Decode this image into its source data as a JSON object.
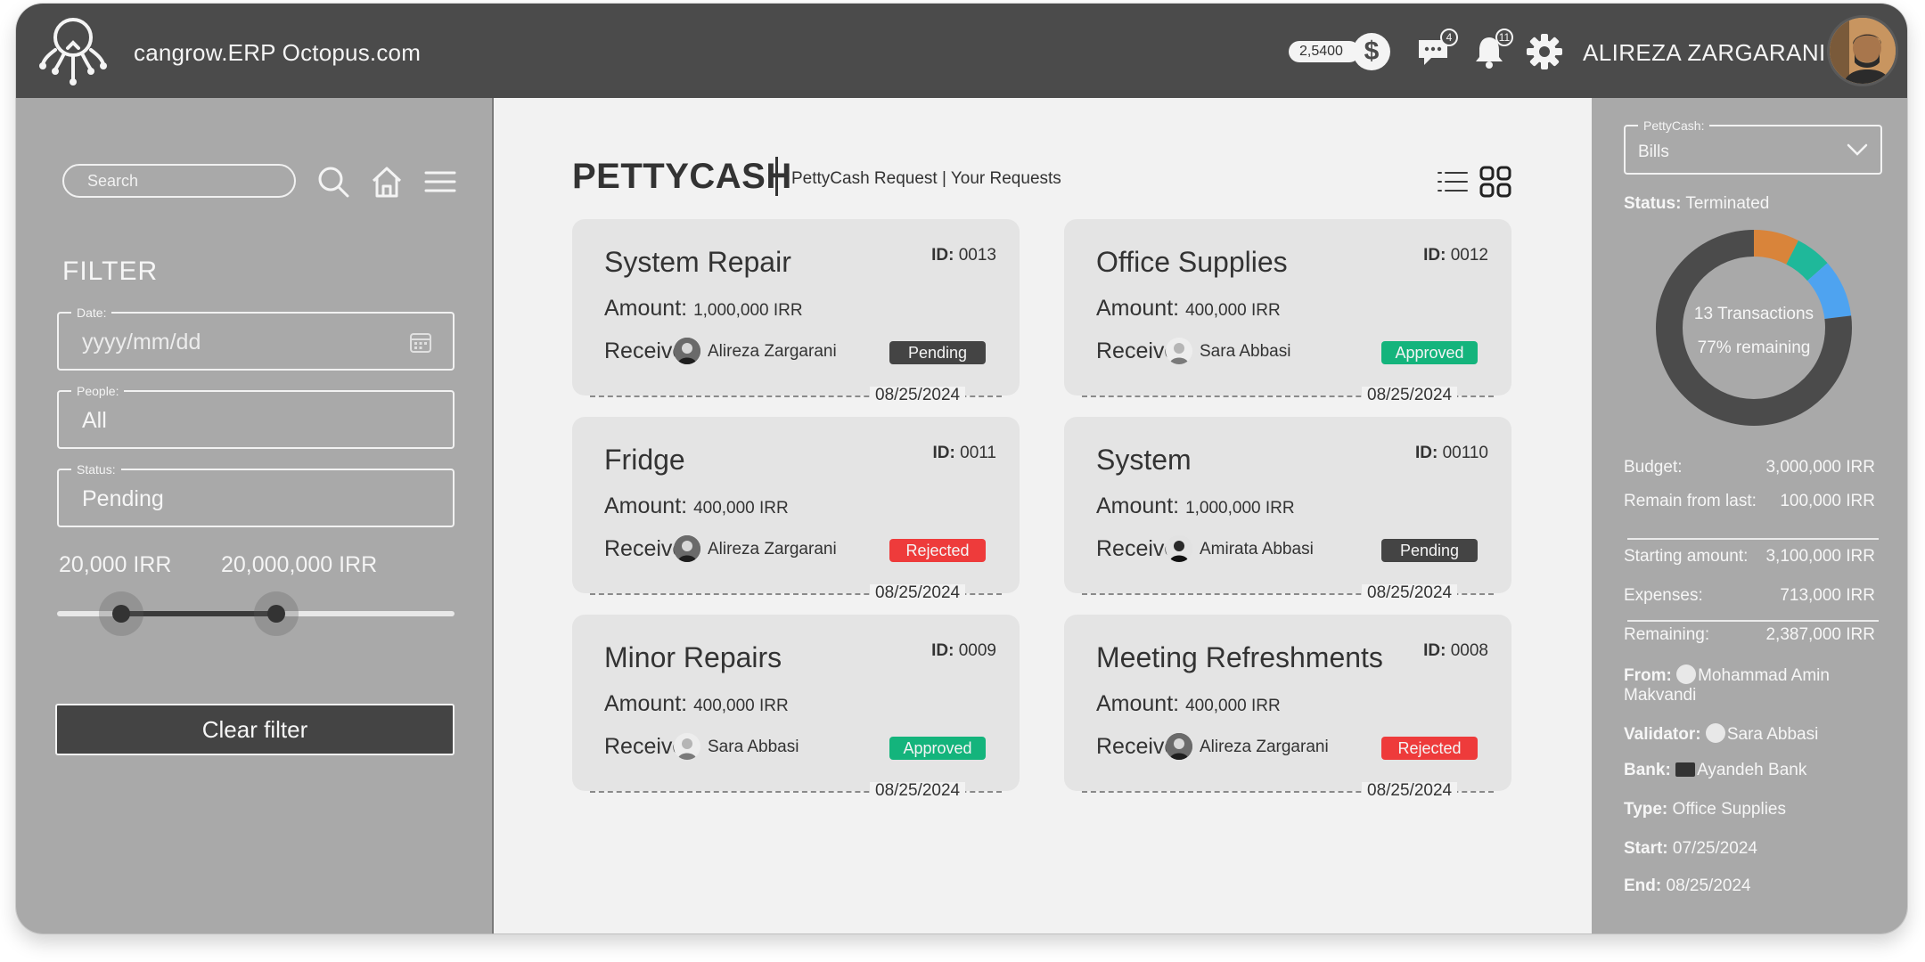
{
  "header": {
    "app_title": "cangrow.ERP Octopus.com",
    "balance": "2,5400",
    "currency_symbol": "$",
    "messages_count": "4",
    "notifications_count": "11",
    "user_name": "ALIREZA ZARGARANI"
  },
  "sidebar": {
    "search_placeholder": "Search",
    "filter_title": "FILTER",
    "date": {
      "label": "Date:",
      "value": "yyyy/mm/dd"
    },
    "people": {
      "label": "People:",
      "value": "All"
    },
    "status": {
      "label": "Status:",
      "value": "Pending"
    },
    "range_min": "20,000 IRR",
    "range_max": "20,000,000 IRR",
    "range_min_fraction": 0.16,
    "range_max_fraction": 0.55,
    "clear_button": "Clear filter"
  },
  "main": {
    "title": "PETTYCASH",
    "breadcrumb": "PettyCash Request | Your Requests",
    "amount_label": "Amount:",
    "receiver_label": "Receiver:",
    "id_label": "ID:",
    "cards": [
      {
        "title": "System Repair",
        "id": "0013",
        "amount": "1,000,000 IRR",
        "receiver": "Alireza Zargarani",
        "status": "Pending",
        "date": "08/25/2024"
      },
      {
        "title": "Office Supplies",
        "id": "0012",
        "amount": "400,000 IRR",
        "receiver": "Sara Abbasi",
        "status": "Approved",
        "date": "08/25/2024"
      },
      {
        "title": "Fridge",
        "id": "0011",
        "amount": "400,000 IRR",
        "receiver": "Alireza Zargarani",
        "status": "Rejected",
        "date": "08/25/2024"
      },
      {
        "title": "System",
        "id": "00110",
        "amount": "1,000,000 IRR",
        "receiver": "Amirata Abbasi",
        "status": "Pending",
        "date": "08/25/2024"
      },
      {
        "title": "Minor Repairs",
        "id": "0009",
        "amount": "400,000 IRR",
        "receiver": "Sara Abbasi",
        "status": "Approved",
        "date": "08/25/2024"
      },
      {
        "title": "Meeting Refreshments",
        "id": "0008",
        "amount": "400,000 IRR",
        "receiver": "Alireza Zargarani",
        "status": "Rejected",
        "date": "08/25/2024"
      }
    ]
  },
  "details": {
    "pettycash_label": "PettyCash:",
    "pettycash_value": "Bills",
    "status_label": "Status:",
    "status_value": "Terminated",
    "transactions": "13 Transactions",
    "remaining_pct": "77% remaining",
    "donut_segments": [
      {
        "fraction": 0.075,
        "color": "#d9843a"
      },
      {
        "fraction": 0.06,
        "color": "#1fb89a"
      },
      {
        "fraction": 0.095,
        "color": "#4ea3f0"
      },
      {
        "fraction": 0.77,
        "color": "#4b4b4b"
      }
    ],
    "budget_label": "Budget:",
    "budget": "3,000,000 IRR",
    "remain_last_label": "Remain from last:",
    "remain_last": "100,000 IRR",
    "starting_label": "Starting amount:",
    "starting": "3,100,000 IRR",
    "expenses_label": "Expenses:",
    "expenses": "713,000 IRR",
    "remaining_label": "Remaining:",
    "remaining": "2,387,000 IRR",
    "from_label": "From:",
    "from_line1": "Mohammad Amin",
    "from_line2": "Makvandi",
    "validator_label": "Validator:",
    "validator": "Sara Abbasi",
    "bank_label": "Bank:",
    "bank": "Ayandeh Bank",
    "type_label": "Type:",
    "type": "Office Supplies",
    "start_label": "Start:",
    "start": "07/25/2024",
    "end_label": "End:",
    "end": "08/25/2024"
  },
  "colors": {
    "header_bg": "#4b4b4b",
    "sidebar_bg": "#a9a9a9",
    "main_bg": "#f2f2f2",
    "card_bg": "#e4e4e4",
    "pending": "#444444",
    "approved": "#14b47c",
    "rejected": "#ee3b3b"
  },
  "icons": [
    "logo-icon",
    "dollar-icon",
    "chat-icon",
    "bell-icon",
    "gear-icon",
    "search-icon",
    "home-icon",
    "menu-icon",
    "calendar-icon",
    "list-view-icon",
    "grid-view-icon",
    "chevron-down-icon",
    "bank-icon"
  ]
}
